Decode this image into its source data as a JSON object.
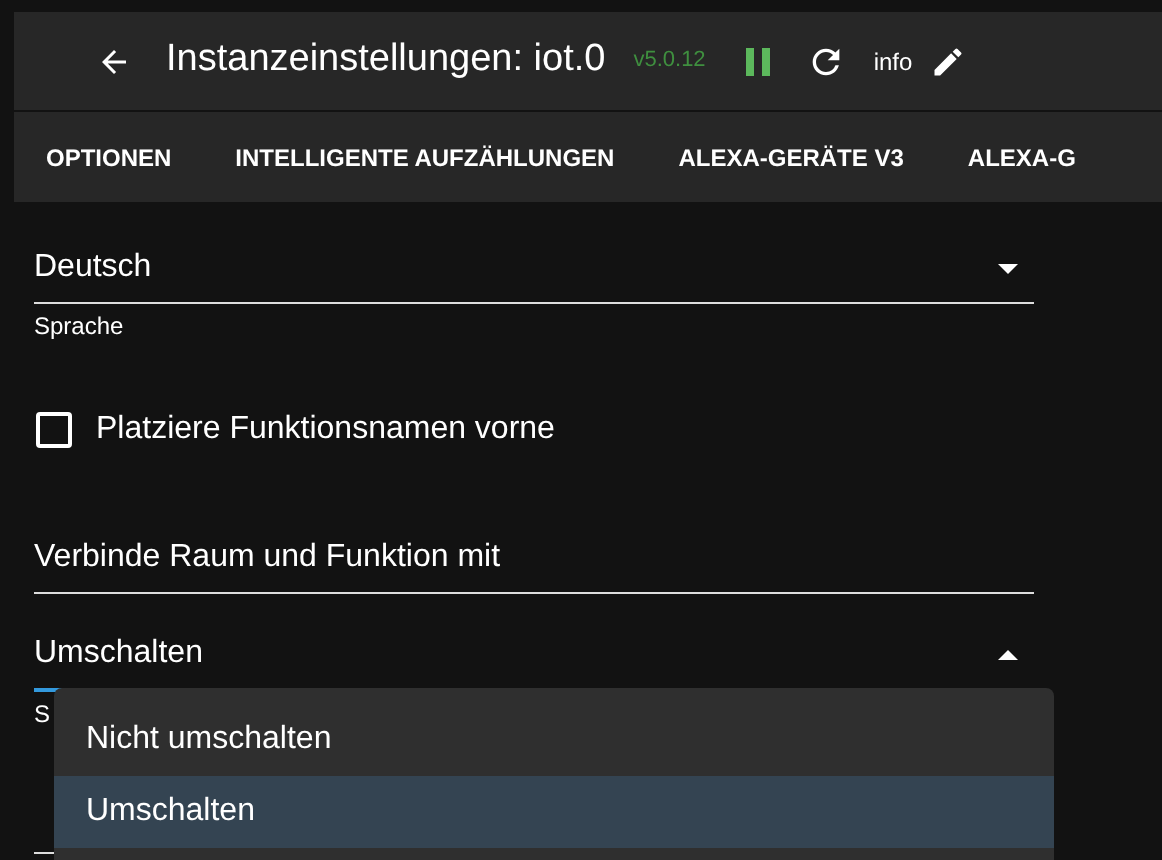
{
  "header": {
    "title": "Instanzeinstellungen: iot.0",
    "version": "v5.0.12",
    "running": true,
    "info_label": "info"
  },
  "tabs": [
    {
      "label": "OPTIONEN",
      "selected": false
    },
    {
      "label": "INTELLIGENTE AUFZÄHLUNGEN",
      "selected": false
    },
    {
      "label": "ALEXA-GERÄTE V3",
      "selected": false
    },
    {
      "label": "ALEXA-G",
      "selected": false
    }
  ],
  "language_select": {
    "value": "Deutsch",
    "helper": "Sprache",
    "expanded": false
  },
  "checkbox": {
    "label": "Platziere Funktionsnamen vorne",
    "checked": false
  },
  "connect_field": {
    "value": "Verbinde Raum und Funktion mit"
  },
  "switch_select": {
    "value": "Umschalten",
    "helper": "S",
    "expanded": true
  },
  "menu": {
    "items": [
      {
        "label": "Nicht umschalten",
        "selected": false
      },
      {
        "label": "Umschalten",
        "selected": true
      }
    ]
  }
}
